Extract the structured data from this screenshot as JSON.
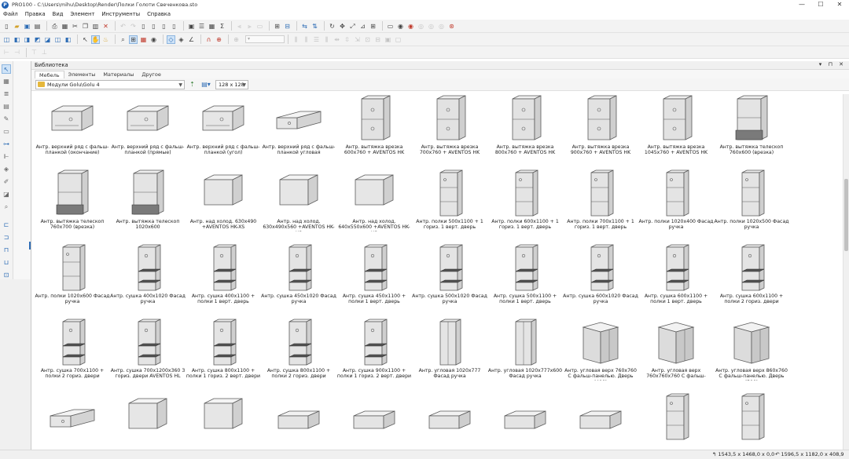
{
  "titlebar": {
    "app_icon": "pro100-logo-icon",
    "title": "PRO100 - C:\\Users\\mihu\\Desktop\\Render\\Полки Голоти Свеченкова.sto",
    "controls": [
      "—",
      "☐",
      "✕"
    ]
  },
  "menu": [
    "Файл",
    "Правка",
    "Вид",
    "Элемент",
    "Инструменты",
    "Справка"
  ],
  "library": {
    "title": "Библиотека",
    "header_controls": "▾ ⊓ ✕",
    "tabs": [
      "Мебель",
      "Элементы",
      "Материалы",
      "Другое"
    ],
    "active_tab": "Мебель",
    "path": "Модули Golu\\Golu 4",
    "thumb_size": "128 x 128",
    "view_icon": "view-mode-icon"
  },
  "items": [
    "Антр. верхний ряд с фальш-планкой (окончание)",
    "Антр. верхний ряд с фальш-планкой (прямые)",
    "Антр. верхний ряд с фальш-планкой (угол)",
    "Антр. верхний ряд с фальш-планкой угловая",
    "Антр. вытяжка врезка 600x760 + AVENTOS HK",
    "Антр. вытяжка врезка 700x760 + AVENTOS HK",
    "Антр. вытяжка врезка 800x760 + AVENTOS HK",
    "Антр. вытяжка врезка 900x760 + AVENTOS HK",
    "Антр. вытяжка врезка 1045x760 + AVENTOS HK",
    "Антр. вытяжка телескоп 760x600 (врезка)",
    "Антр. вытяжка телескоп 760x700 (врезка)",
    "Антр. вытяжка телескоп 1020x600",
    "Антр. над холод. 630x490 +AVENTOS HK-XS",
    "Антр. над холод. 630x490x560 +AVENTOS HK-XS",
    "Антр. над холод. 640x550x600 +AVENTOS HK-XS",
    "Антр. полки 500x1100 + 1 гориз. 1 верт. дверь",
    "Антр. полки 600x1100 + 1 гориз. 1 верт. дверь",
    "Антр. полки 700x1100 + 1 гориз. 1 верт. дверь",
    "Антр. полки 1020x400 Фасад ручка",
    "Антр. полки 1020x500 Фасад ручка",
    "Антр. полки 1020x600 Фасад ручка",
    "Антр. сушка 400x1020 Фасад ручка",
    "Антр. сушка 400x1100 + полки 1 верт. дверь",
    "Антр. сушка 450x1020 Фасад ручка",
    "Антр. сушка 450x1100 + полки 1 верт. дверь",
    "Антр. сушка 500x1020 Фасад ручка",
    "Антр. сушка 500x1100 + полки 1 верт. дверь",
    "Антр. сушка 600x1020 Фасад ручка",
    "Антр. сушка 600x1100 + полки 1 верт. дверь",
    "Антр. сушка 600x1100 + полки 2 гориз. двери",
    "Антр. сушка 700x1100 + полки 2 гориз. двери",
    "Антр. сушка 700x1200x360 3 гориз. двери AVENTOS HL",
    "Антр. сушка 800x1100 + полки 1 гориз. 2 верт. двери",
    "Антр. сушка 800x1100 + полки 2 гориз. двери",
    "Антр. сушка 900x1100 + полки 1 гориз. 2 верт. двери",
    "Антр. угловая 1020x777 Фасад ручка",
    "Антр. угловая 1020x777x600 Фасад ручка",
    "Антр. угловая верх 760x760 С фальш-панелью. Дверь (400)",
    "Антр. угловая верх 760x760x760 С фальш-панель...",
    "Антр. угловая верх 860x760 С фальш-панелью. Дверь (500)",
    "",
    "",
    "",
    "",
    "",
    "",
    "",
    "",
    "",
    ""
  ],
  "thumb_kinds": [
    "low",
    "low",
    "low",
    "lshape",
    "tall2",
    "tall2",
    "tall2",
    "tall2",
    "tall2",
    "telescope",
    "telescope",
    "telescope",
    "box",
    "box",
    "box",
    "tall",
    "tall",
    "tall",
    "tall",
    "tall",
    "tall",
    "dryer",
    "dryer",
    "dryer",
    "dryer",
    "dryer",
    "dryer",
    "dryer",
    "dryer",
    "dryer",
    "dryer",
    "dryer",
    "dryer",
    "dryer",
    "dryer",
    "corner",
    "corner",
    "cornerbox",
    "cornerbox",
    "cornerbox",
    "lshape",
    "box",
    "box",
    "flat",
    "flat",
    "flat",
    "flat",
    "flat",
    "tall",
    "tall"
  ],
  "status": {
    "left": "↰ 1543,5 x 1468,0 x 0,0",
    "right": "↶ 1596,5 x 1182,0 x 408,9"
  },
  "colors": {
    "accent": "#2d6cb5",
    "selection": "#cfe3f7",
    "folder": "#e5b73b"
  }
}
